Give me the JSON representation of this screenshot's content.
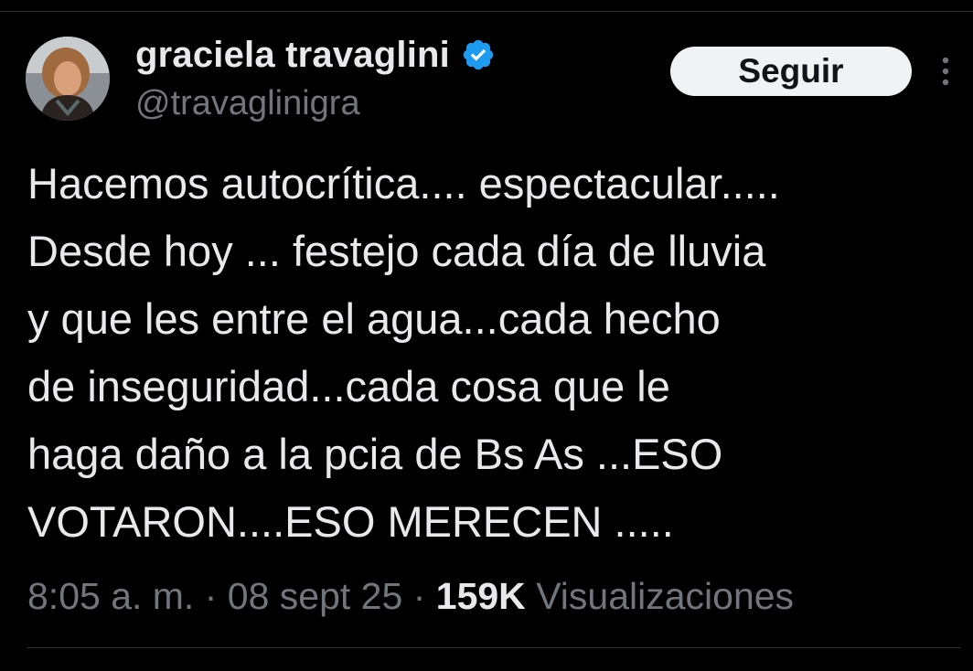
{
  "author": {
    "display_name": "graciela travaglini",
    "handle": "@travaglinigra",
    "verified": true,
    "avatar_icon": "profile-photo"
  },
  "actions": {
    "follow_label": "Seguir",
    "more_icon": "more-vertical-icon"
  },
  "tweet": {
    "lines": [
      "Hacemos autocrítica.... espectacular.....",
      "Desde hoy ... festejo cada día de lluvia",
      "y que les entre el agua...cada hecho",
      "de inseguridad...cada cosa que le",
      "haga daño a la pcia de Bs As ...ESO",
      "VOTARON....ESO MERECEN ....."
    ]
  },
  "meta": {
    "time": "8:05 a. m.",
    "separator": "·",
    "date": "08 sept 25",
    "views_count": "159K",
    "views_label": "Visualizaciones"
  },
  "colors": {
    "background": "#000000",
    "text_primary": "#e7e9ea",
    "text_secondary": "#71767b",
    "verified_blue": "#1d9bf0",
    "button_bg": "#eff3f4"
  }
}
